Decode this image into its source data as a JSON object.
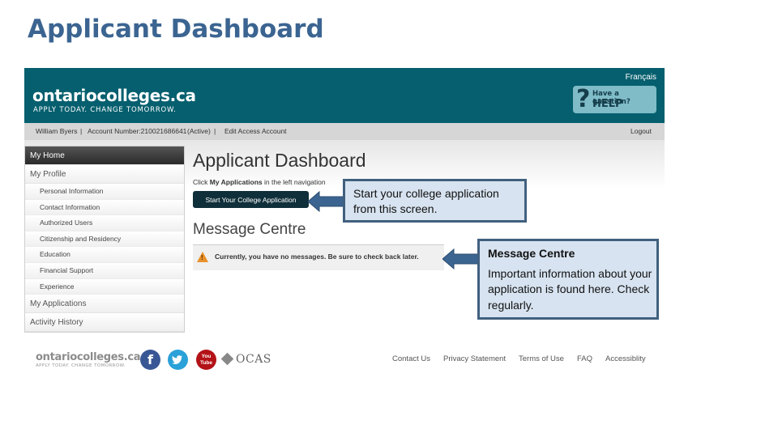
{
  "slide": {
    "title": "Applicant Dashboard"
  },
  "site": {
    "logo": "ontariocolleges.ca",
    "tagline": "APPLY TODAY. CHANGE TOMORROW.",
    "language_link": "Français",
    "help": {
      "icon": "?",
      "small": "Have a question?",
      "big": "HELP"
    }
  },
  "account": {
    "name": "William Byers",
    "separator": "|",
    "number": "Account Number:210021686641",
    "status": "(Active)",
    "edit_link": "Edit Access Account",
    "logout": "Logout"
  },
  "sidebar": {
    "items": [
      {
        "label": "My Home",
        "level": "top",
        "active": true
      },
      {
        "label": "My Profile",
        "level": "top"
      },
      {
        "label": "Personal Information",
        "level": "sub"
      },
      {
        "label": "Contact Information",
        "level": "sub"
      },
      {
        "label": "Authorized Users",
        "level": "sub"
      },
      {
        "label": "Citizenship and Residency",
        "level": "sub"
      },
      {
        "label": "Education",
        "level": "sub"
      },
      {
        "label": "Financial Support",
        "level": "sub"
      },
      {
        "label": "Experience",
        "level": "sub"
      },
      {
        "label": "My Applications",
        "level": "top"
      },
      {
        "label": "Activity History",
        "level": "top"
      }
    ]
  },
  "main": {
    "heading": "Applicant Dashboard",
    "instruction_prefix": "Click ",
    "instruction_bold": "My Applications",
    "instruction_suffix": " in the left navigation",
    "start_button": "Start Your College Application",
    "message_centre_heading": "Message Centre",
    "message_text": "Currently, you have no messages. Be sure to check back later.",
    "warning_mark": "!"
  },
  "footer": {
    "logo": "ontariocolleges.ca",
    "tagline": "APPLY TODAY. CHANGE TOMORROW.",
    "social": {
      "facebook": "f",
      "twitter": "t",
      "youtube_top": "You",
      "youtube_bottom": "Tube"
    },
    "ocas": "OCAS",
    "links": [
      "Contact Us",
      "Privacy Statement",
      "Terms of Use",
      "FAQ",
      "Accessiblity"
    ]
  },
  "callouts": {
    "start": {
      "text": "Start your college application  from this screen."
    },
    "message_centre": {
      "title": "Message Centre",
      "text": "Important information about your application is found here. Check regularly."
    }
  },
  "colors": {
    "brand_teal": "#055f6e",
    "callout_fill": "#d7e3f0",
    "callout_border": "#41607f",
    "arrow": "#3b6491",
    "slide_title": "#3b6491"
  }
}
